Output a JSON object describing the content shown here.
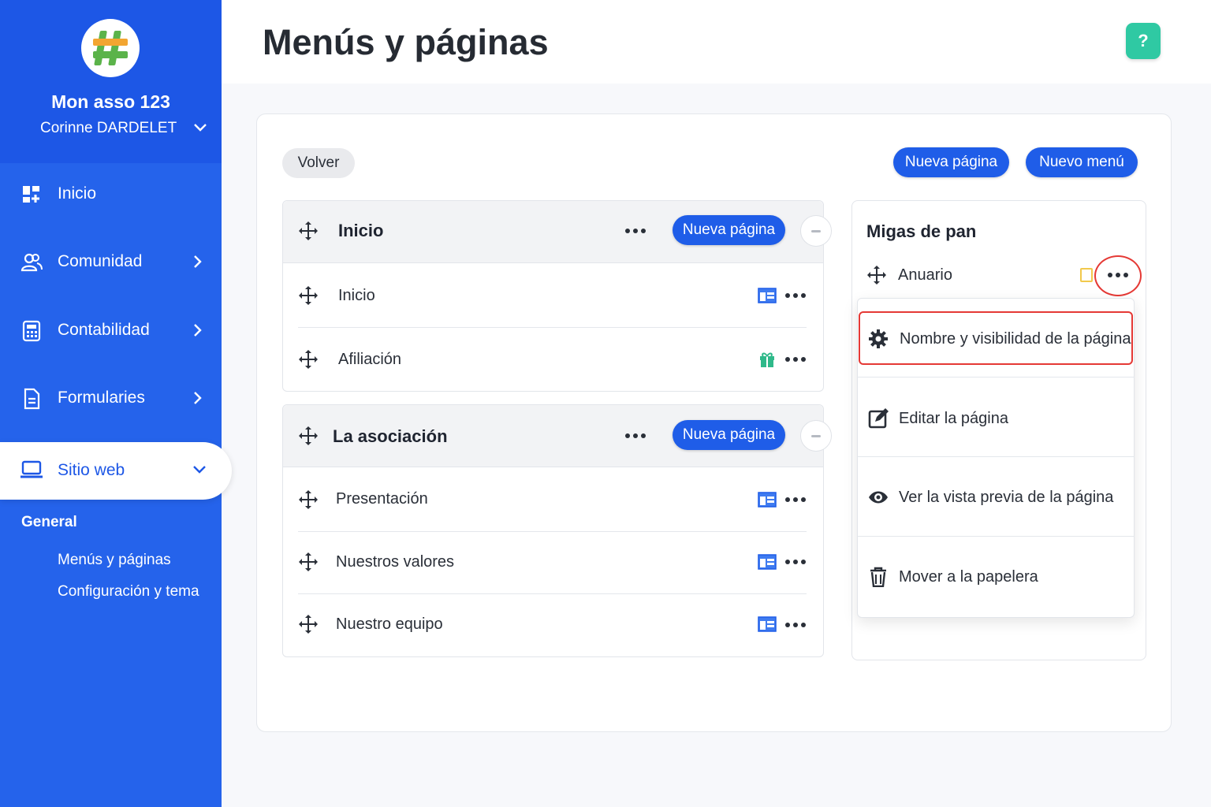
{
  "sidebar": {
    "org_name": "Mon asso 123",
    "user_name": "Corinne DARDELET",
    "items": [
      {
        "label": "Inicio"
      },
      {
        "label": "Comunidad"
      },
      {
        "label": "Contabilidad"
      },
      {
        "label": "Formularies"
      },
      {
        "label": "Sitio web"
      }
    ],
    "section_title": "General",
    "sub_links": [
      "Menús y páginas",
      "Configuración y tema"
    ]
  },
  "header": {
    "title": "Menús y páginas",
    "help": "?"
  },
  "toolbar": {
    "back": "Volver",
    "new_page": "Nueva página",
    "new_menu": "Nuevo menú"
  },
  "menus": [
    {
      "title": "Inicio",
      "new_page": "Nueva página",
      "pages": [
        {
          "label": "Inicio",
          "icon": "page-icon"
        },
        {
          "label": "Afiliación",
          "icon": "gift-icon"
        }
      ]
    },
    {
      "title": "La asociación",
      "new_page": "Nueva página",
      "pages": [
        {
          "label": "Presentación",
          "icon": "page-icon"
        },
        {
          "label": "Nuestros valores",
          "icon": "page-icon"
        },
        {
          "label": "Nuestro equipo",
          "icon": "page-icon"
        }
      ]
    }
  ],
  "breadcrumbs": {
    "title": "Migas de pan",
    "item": "Anuario",
    "menu": [
      {
        "label": "Nombre y visibilidad de la página",
        "icon": "gear-icon"
      },
      {
        "label": "Editar la página",
        "icon": "edit-icon"
      },
      {
        "label": "Ver la vista previa de la página",
        "icon": "eye-icon"
      },
      {
        "label": "Mover a la papelera",
        "icon": "trash-icon"
      }
    ]
  },
  "colors": {
    "primary": "#2563eb",
    "button": "#1f5de8",
    "help": "#2fc9a3",
    "highlight": "#e53935"
  }
}
